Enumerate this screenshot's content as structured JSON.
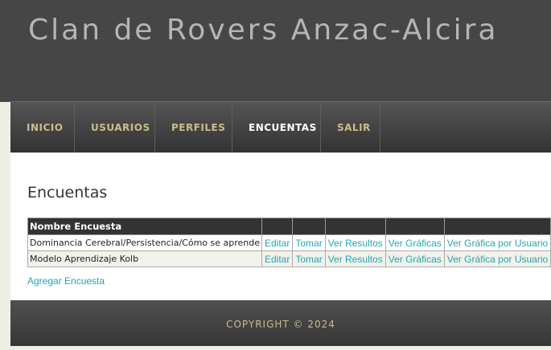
{
  "site": {
    "title": "Clan de Rovers Anzac-Alcira"
  },
  "nav": {
    "items": [
      {
        "label": "INICIO"
      },
      {
        "label": "USUARIOS"
      },
      {
        "label": "PERFILES"
      },
      {
        "label": "ENCUENTAS",
        "active": true
      },
      {
        "label": "SALIR"
      }
    ]
  },
  "main": {
    "heading": "Encuentas",
    "table": {
      "header": "Nombre Encuesta",
      "rows": [
        {
          "name": "Dominancia Cerebral/Persistencia/Cómo se aprende",
          "edit": "Editar",
          "take": "Tomar",
          "results": "Ver Resultos",
          "charts": "Ver Gráficas",
          "user_chart": "Ver Gráfica por Usuario"
        },
        {
          "name": "Modelo Aprendizaje Kolb",
          "edit": "Editar",
          "take": "Tomar",
          "results": "Ver Resultos",
          "charts": "Ver Gráficas",
          "user_chart": "Ver Gráfica por Usuario"
        }
      ]
    },
    "add_link": "Agregar Encuesta"
  },
  "footer": {
    "copyright": "COPYRIGHT © 2024"
  },
  "colors": {
    "link": "#1fa7b5",
    "nav_text": "#c9bd8a",
    "header_bg": "#464646"
  }
}
